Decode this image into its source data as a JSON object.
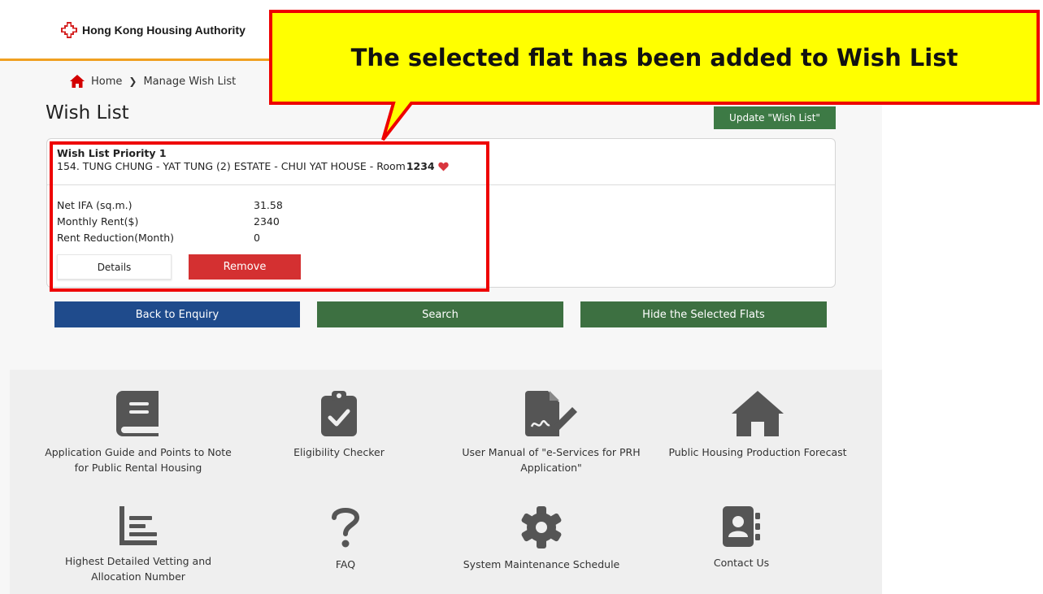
{
  "header": {
    "logo_text": "Hong Kong Housing Authority",
    "accent_color": "#f0a020"
  },
  "breadcrumb": {
    "home": "Home",
    "current": "Manage Wish List"
  },
  "page": {
    "title": "Wish List",
    "update_button": "Update \"Wish List\""
  },
  "wish_item": {
    "priority": "Wish List Priority 1",
    "flat_text": "154. TUNG CHUNG - YAT TUNG (2) ESTATE - CHUI YAT HOUSE - Room",
    "room_number": "1234",
    "rows": [
      {
        "label": "Net IFA (sq.m.)",
        "value": "31.58"
      },
      {
        "label": "Monthly Rent($)",
        "value": "2340"
      },
      {
        "label": "Rent Reduction(Month)",
        "value": "0"
      }
    ],
    "details_button": "Details",
    "remove_button": "Remove"
  },
  "actions": {
    "back": "Back to Enquiry",
    "search": "Search",
    "hide": "Hide the Selected Flats"
  },
  "callout": {
    "text": "The selected flat has been added to Wish List",
    "fill_color": "#ffff00",
    "border_color": "#ee0000"
  },
  "footer": {
    "tiles": [
      {
        "label": "Application Guide and Points to Note for Public Rental Housing",
        "icon": "book-icon"
      },
      {
        "label": "Eligibility Checker",
        "icon": "clipboard-check-icon"
      },
      {
        "label": "User Manual of \"e-Services for PRH Application\"",
        "icon": "file-signature-icon"
      },
      {
        "label": "Public Housing Production Forecast",
        "icon": "house-icon"
      },
      {
        "label": "Highest Detailed Vetting and Allocation Number",
        "icon": "list-chart-icon"
      },
      {
        "label": "FAQ",
        "icon": "question-mark-icon"
      },
      {
        "label": "System Maintenance Schedule",
        "icon": "gear-icon"
      },
      {
        "label": "Contact Us",
        "icon": "address-book-icon"
      }
    ]
  }
}
